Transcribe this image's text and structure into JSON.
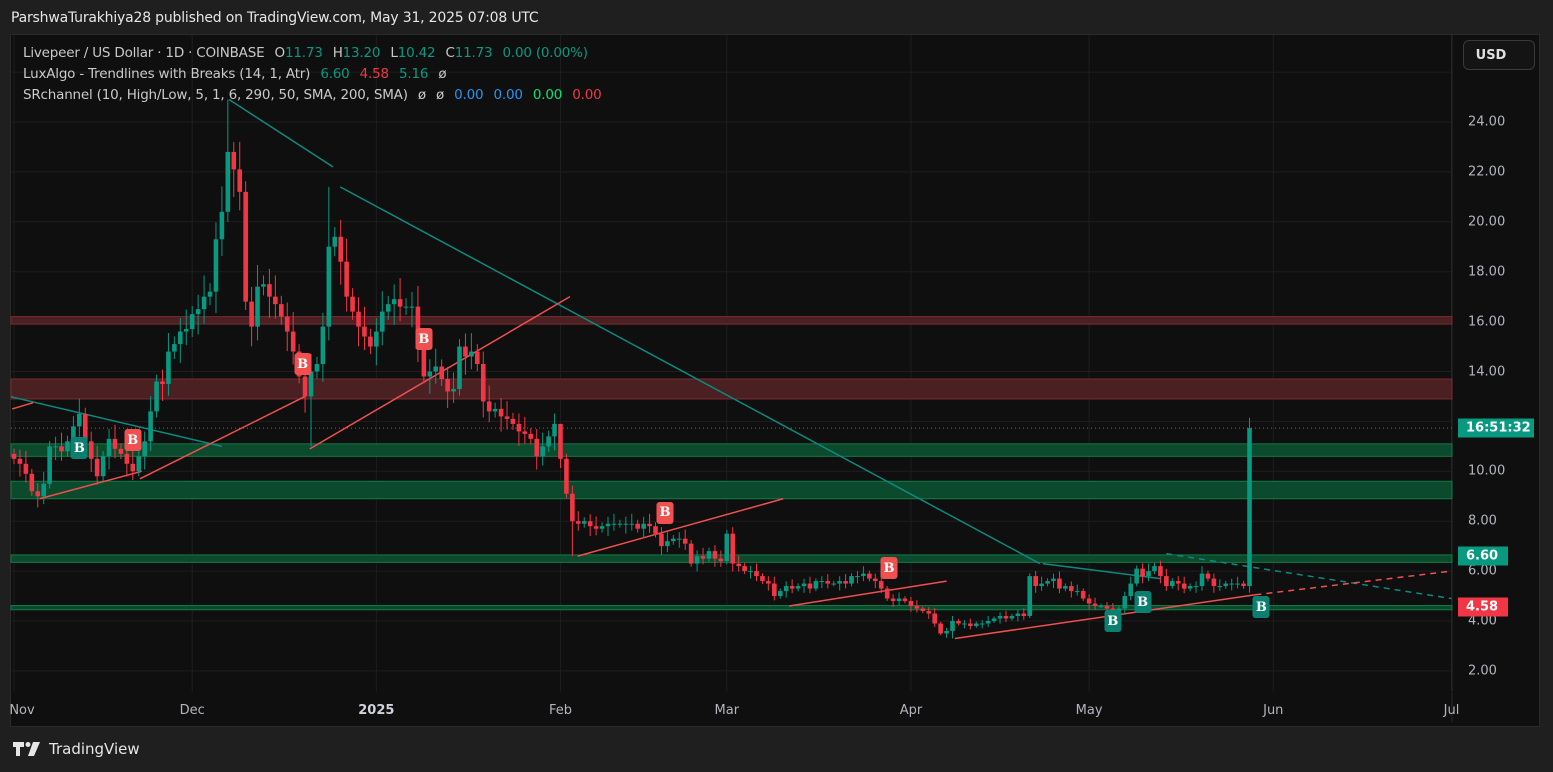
{
  "publish_line": "ParshwaTurakhiya28 published on TradingView.com, May 31, 2025 07:08 UTC",
  "legend": {
    "symbol": "Livepeer / US Dollar · 1D · COINBASE",
    "o_label": "O",
    "o": "11.73",
    "h_label": "H",
    "h": "13.20",
    "l_label": "L",
    "l": "10.42",
    "c_label": "C",
    "c": "11.73",
    "change": "0.00 (0.00%)",
    "lux_name": "LuxAlgo - Trendlines with Breaks (14, 1, Atr)",
    "lux_v1": "6.60",
    "lux_v2": "4.58",
    "lux_v3": "5.16",
    "lux_v4": "ø",
    "sr_name": "SRchannel (10, High/Low, 5, 1, 6, 290, 50, SMA, 200, SMA)",
    "sr_v1": "ø",
    "sr_v2": "ø",
    "sr_v3": "0.00",
    "sr_v4": "0.00",
    "sr_v5": "0.00",
    "sr_v6": "0.00"
  },
  "currency_button": "USD",
  "footer_brand": "TradingView",
  "colors": {
    "up": "#089981",
    "down": "#f23645",
    "support_zone": "#0b4a2d",
    "resistance_zone": "#4a2022"
  },
  "chart_data": {
    "type": "candlestick",
    "title": "Livepeer / US Dollar · 1D · COINBASE",
    "start_date": "2024-11-01",
    "ylim": [
      1.2,
      26
    ],
    "y_ticks": [
      "24.00",
      "22.00",
      "20.00",
      "18.00",
      "16.00",
      "14.00",
      "10.00",
      "8.00",
      "6.00",
      "4.00",
      "2.00"
    ],
    "x_ticks": [
      {
        "label": "Nov",
        "day": 0,
        "bold": false
      },
      {
        "label": "Dec",
        "day": 30,
        "bold": false
      },
      {
        "label": "2025",
        "day": 61,
        "bold": true
      },
      {
        "label": "Feb",
        "day": 92,
        "bold": false
      },
      {
        "label": "Mar",
        "day": 120,
        "bold": false
      },
      {
        "label": "Apr",
        "day": 151,
        "bold": false
      },
      {
        "label": "May",
        "day": 181,
        "bold": false
      },
      {
        "label": "Jun",
        "day": 212,
        "bold": false
      },
      {
        "label": "Jul",
        "day": 242,
        "bold": false
      }
    ],
    "first_open": 10.7,
    "closes": [
      10.5,
      10.3,
      9.9,
      9.2,
      9.0,
      9.5,
      11.0,
      11.0,
      10.8,
      11.2,
      11.8,
      12.3,
      11.2,
      10.5,
      9.8,
      10.6,
      11.3,
      10.9,
      10.7,
      10.3,
      10.0,
      10.6,
      11.2,
      12.4,
      13.6,
      13.5,
      14.8,
      15.1,
      15.6,
      15.7,
      16.3,
      16.5,
      17.0,
      17.2,
      19.3,
      20.4,
      22.8,
      22.1,
      21.2,
      16.8,
      15.8,
      17.4,
      17.5,
      17.0,
      16.7,
      16.2,
      15.6,
      14.8,
      13.8,
      13.0,
      14.0,
      14.3,
      15.8,
      19.0,
      19.4,
      18.4,
      17.0,
      16.4,
      15.8,
      15.4,
      15.0,
      15.6,
      16.4,
      16.7,
      16.9,
      16.6,
      16.6,
      16.6,
      14.9,
      13.8,
      14.0,
      14.2,
      13.7,
      13.2,
      13.3,
      15.0,
      14.6,
      14.8,
      14.3,
      12.8,
      12.4,
      12.5,
      12.2,
      12.1,
      11.9,
      11.6,
      11.5,
      11.3,
      10.6,
      11.0,
      11.4,
      11.9,
      10.5,
      9.1,
      8.0,
      7.9,
      8.0,
      7.8,
      7.7,
      7.8,
      7.9,
      7.9,
      7.9,
      7.9,
      7.9,
      7.7,
      7.9,
      7.8,
      7.5,
      7.0,
      7.2,
      7.3,
      7.3,
      7.1,
      6.3,
      6.6,
      6.5,
      6.8,
      6.5,
      6.4,
      7.5,
      6.3,
      6.2,
      6.0,
      6.0,
      5.8,
      5.6,
      5.5,
      5.0,
      5.2,
      5.4,
      5.3,
      5.4,
      5.5,
      5.3,
      5.6,
      5.6,
      5.5,
      5.5,
      5.6,
      5.5,
      5.8,
      5.8,
      5.9,
      5.7,
      5.6,
      5.3,
      4.9,
      4.8,
      4.9,
      4.8,
      4.6,
      4.5,
      4.4,
      4.3,
      3.9,
      3.5,
      3.6,
      4.0,
      3.9,
      3.9,
      3.8,
      3.9,
      3.9,
      4.0,
      4.1,
      4.2,
      4.1,
      4.2,
      4.3,
      4.2,
      5.8,
      5.4,
      5.5,
      5.6,
      5.7,
      5.3,
      5.4,
      5.2,
      5.2,
      4.9,
      4.7,
      4.6,
      4.6,
      4.5,
      4.4,
      4.5,
      5.0,
      5.5,
      6.1,
      5.8,
      6.0,
      6.2,
      5.8,
      5.4,
      5.6,
      5.5,
      5.3,
      5.4,
      5.4,
      5.9,
      5.7,
      5.4,
      5.4,
      5.5,
      5.5,
      5.5,
      5.4,
      11.73
    ],
    "high_overrides": [
      {
        "day": 36,
        "high": 24.9
      },
      {
        "day": 37,
        "high": 23.2
      },
      {
        "day": 53,
        "high": 21.4
      },
      {
        "day": 209,
        "high": 14.2
      },
      {
        "day": 92,
        "high": 11.9
      }
    ],
    "low_overrides": [
      {
        "day": 50,
        "low": 11.0
      },
      {
        "day": 94,
        "low": 6.6
      },
      {
        "day": 209,
        "low": 5.3
      },
      {
        "day": 158,
        "low": 3.3
      }
    ],
    "current_price": 11.73,
    "countdown_label": "16:51:32",
    "price_labels": [
      {
        "value": 6.6,
        "text": "6.60",
        "kind": "up"
      },
      {
        "value": 4.58,
        "text": "4.58",
        "kind": "down"
      }
    ],
    "sr_zones": [
      {
        "low": 15.9,
        "high": 16.2,
        "kind": "resistance"
      },
      {
        "low": 12.9,
        "high": 13.7,
        "kind": "resistance"
      },
      {
        "low": 10.6,
        "high": 11.1,
        "kind": "support"
      },
      {
        "low": 8.9,
        "high": 9.6,
        "kind": "support"
      },
      {
        "low": 6.35,
        "high": 6.65,
        "kind": "support"
      },
      {
        "low": 4.45,
        "high": 4.62,
        "kind": "support"
      }
    ],
    "trendlines": [
      {
        "d1": 36.2,
        "p1": 24.9,
        "d2": 53.7,
        "p2": 22.2,
        "kind": "down",
        "dashed": false
      },
      {
        "d1": 54.9,
        "p1": 21.4,
        "d2": 172.7,
        "p2": 6.3,
        "kind": "down",
        "dashed": false
      },
      {
        "d1": -0.7,
        "p1": 13.0,
        "d2": 35,
        "p2": 11.0,
        "kind": "down",
        "dashed": false
      },
      {
        "d1": 173.2,
        "p1": 6.3,
        "d2": 193,
        "p2": 5.7,
        "kind": "down",
        "dashed": false
      },
      {
        "d1": 194,
        "p1": 6.7,
        "d2": 242,
        "p2": 4.9,
        "kind": "down",
        "dashed": true
      },
      {
        "d1": -0.3,
        "p1": 12.5,
        "d2": 3.2,
        "p2": 12.75,
        "kind": "up",
        "dashed": false
      },
      {
        "d1": 4.3,
        "p1": 8.9,
        "d2": 21.5,
        "p2": 10.0,
        "kind": "up",
        "dashed": false
      },
      {
        "d1": 21.2,
        "p1": 9.7,
        "d2": 49,
        "p2": 13.0,
        "kind": "up",
        "dashed": false
      },
      {
        "d1": 49.8,
        "p1": 10.9,
        "d2": 93.6,
        "p2": 17.0,
        "kind": "up",
        "dashed": false
      },
      {
        "d1": 94.9,
        "p1": 6.6,
        "d2": 129.5,
        "p2": 8.9,
        "kind": "up",
        "dashed": false
      },
      {
        "d1": 130.5,
        "p1": 4.6,
        "d2": 157,
        "p2": 5.6,
        "kind": "up",
        "dashed": false
      },
      {
        "d1": 158.4,
        "p1": 3.3,
        "d2": 209,
        "p2": 5.05,
        "kind": "up",
        "dashed": false
      },
      {
        "d1": 209,
        "p1": 5.05,
        "d2": 242,
        "p2": 6.0,
        "kind": "up",
        "dashed": true
      }
    ],
    "break_labels": [
      {
        "day": 11,
        "price": 10.93,
        "text": "B",
        "kind": "up"
      },
      {
        "day": 20,
        "price": 11.25,
        "text": "B",
        "kind": "down"
      },
      {
        "day": 48.6,
        "price": 14.3,
        "text": "B",
        "kind": "down"
      },
      {
        "day": 69,
        "price": 15.3,
        "text": "B",
        "kind": "down"
      },
      {
        "day": 109.6,
        "price": 8.33,
        "text": "B",
        "kind": "down"
      },
      {
        "day": 147.3,
        "price": 6.12,
        "text": "B",
        "kind": "down"
      },
      {
        "day": 185,
        "price": 4.0,
        "text": "B",
        "kind": "up"
      },
      {
        "day": 190,
        "price": 4.76,
        "text": "B",
        "kind": "up"
      },
      {
        "day": 210,
        "price": 4.56,
        "text": "B",
        "kind": "up"
      }
    ]
  }
}
